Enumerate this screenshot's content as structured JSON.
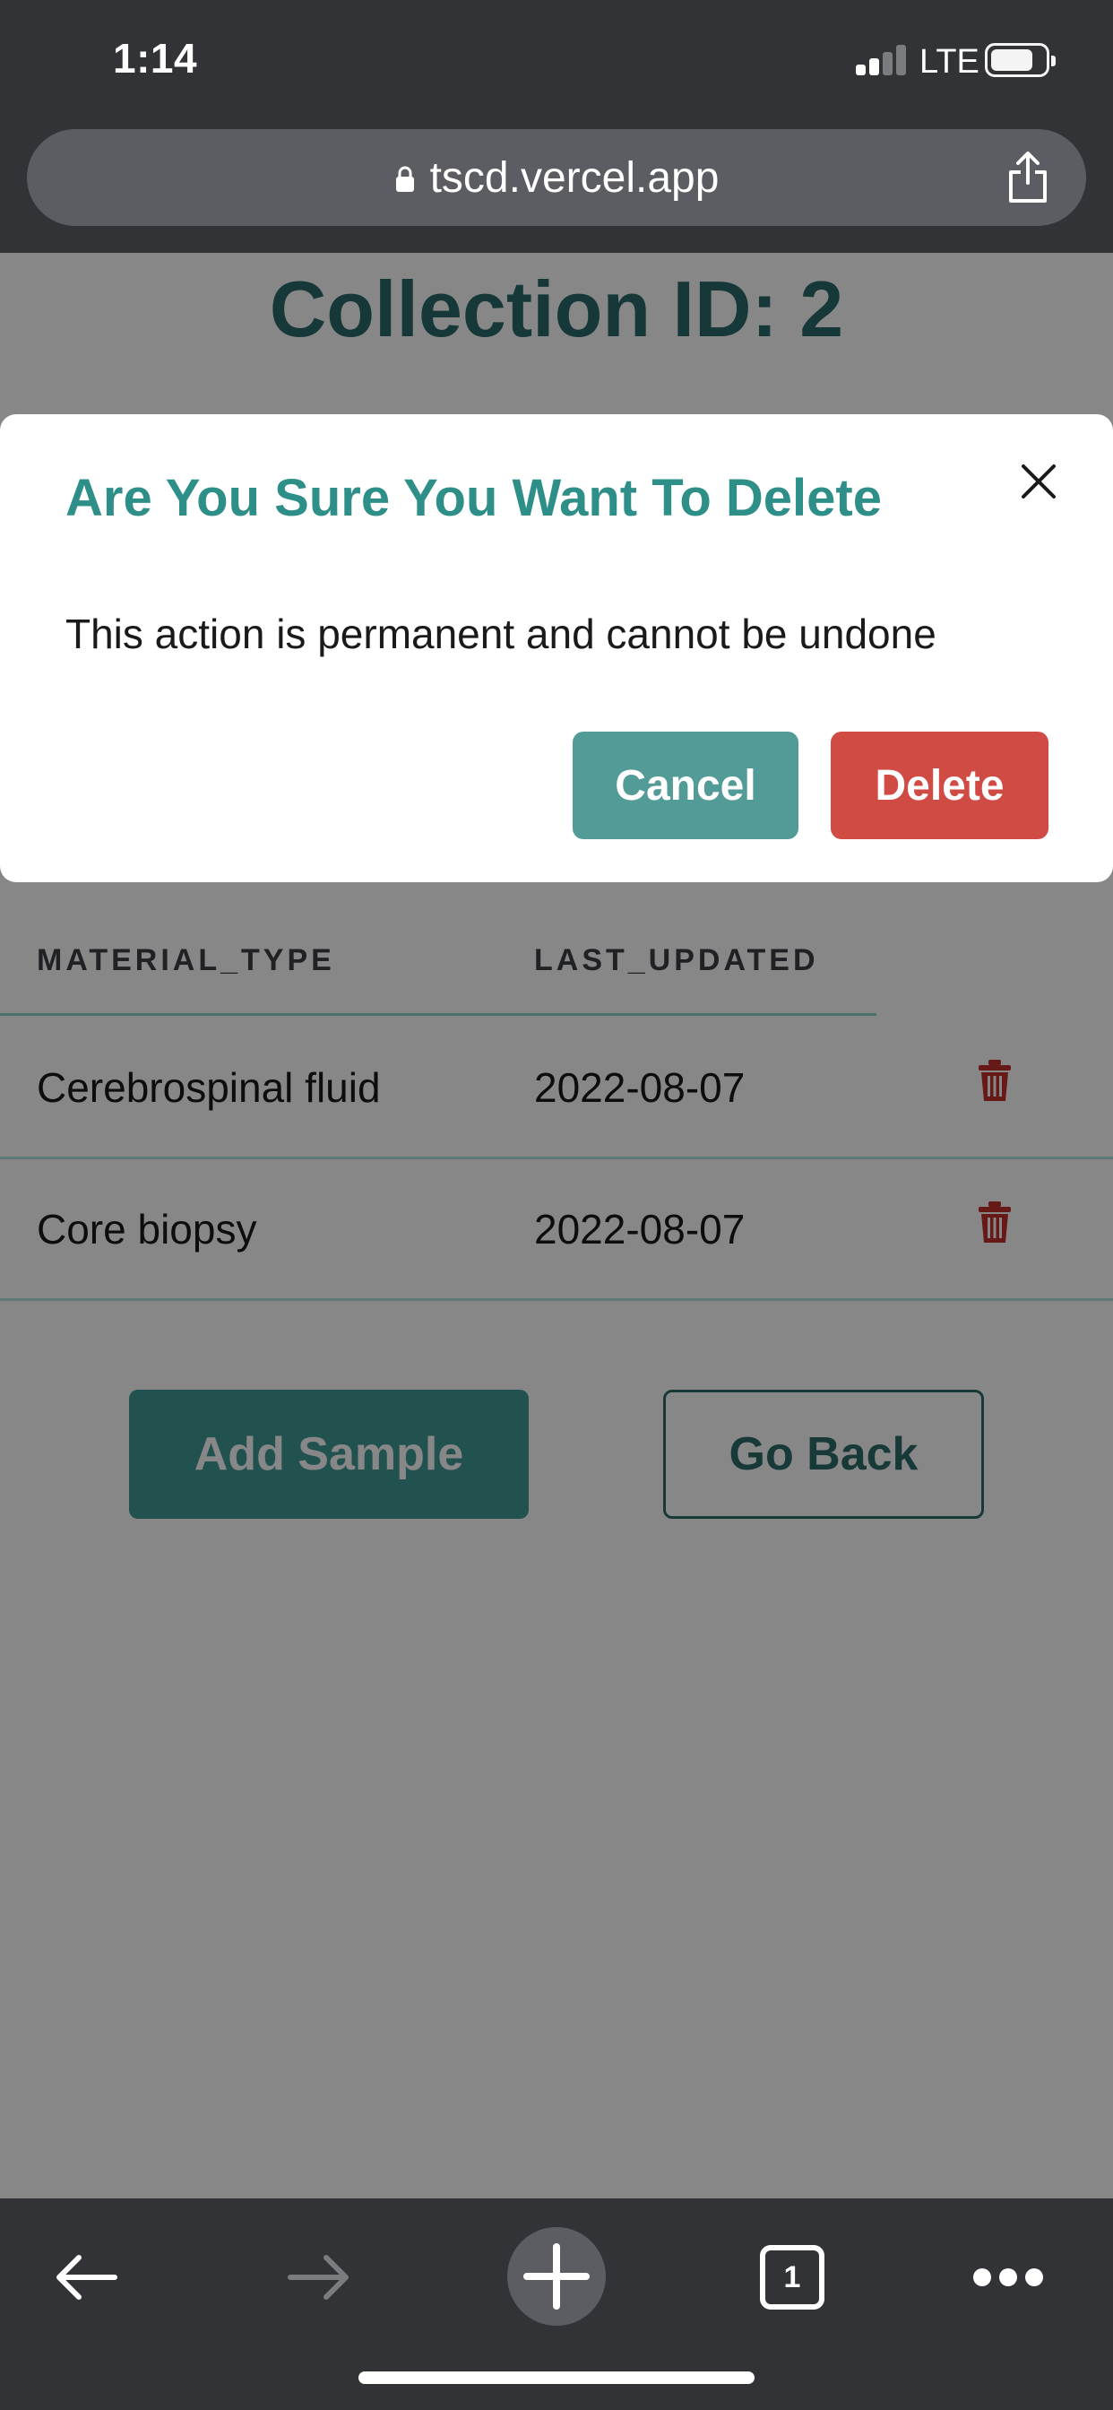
{
  "status_bar": {
    "time": "1:14",
    "network": "LTE"
  },
  "browser": {
    "url": "tscd.vercel.app",
    "tab_count": "1"
  },
  "page": {
    "title": "Collection ID: 2",
    "table": {
      "headers": [
        "MATERIAL_TYPE",
        "LAST_UPDATED"
      ],
      "rows": [
        {
          "material_type": "Cerebrospinal fluid",
          "last_updated": "2022-08-07"
        },
        {
          "material_type": "Core biopsy",
          "last_updated": "2022-08-07"
        }
      ]
    },
    "buttons": {
      "add_sample": "Add Sample",
      "go_back": "Go Back"
    }
  },
  "modal": {
    "title": "Are You Sure You Want To Delete",
    "body": "This action is permanent and cannot be undone",
    "cancel_label": "Cancel",
    "delete_label": "Delete"
  },
  "colors": {
    "accent": "#2e8f88",
    "danger": "#d14b45",
    "chrome": "#323336"
  }
}
